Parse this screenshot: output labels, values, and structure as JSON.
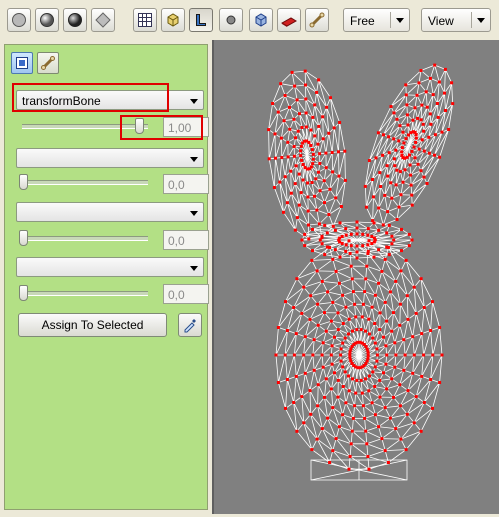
{
  "toolbar": {
    "camera_combo": "Free",
    "view_combo": "View",
    "icons": [
      "sphere-icon",
      "sphere-shaded-icon",
      "sphere-dark-icon",
      "diamond-icon",
      "grid-icon",
      "cube-bones-icon",
      "select-icon",
      "vertex-icon",
      "cube-wire-icon",
      "paint-icon",
      "bone-icon"
    ]
  },
  "panel": {
    "tabs": [
      "mesh-tab",
      "bone-tab"
    ],
    "bone_slots": [
      {
        "bone": "transformBone",
        "weight": "1,00"
      },
      {
        "bone": "",
        "weight": "0,0"
      },
      {
        "bone": "",
        "weight": "0,0"
      },
      {
        "bone": "",
        "weight": "0,0"
      }
    ],
    "assign_label": "Assign To Selected"
  },
  "colors": {
    "panel_bg": "#b3e085",
    "viewport_bg": "#808080",
    "highlight": "#e00000",
    "vertex": "#ff0000",
    "wire": "#ffffff"
  }
}
